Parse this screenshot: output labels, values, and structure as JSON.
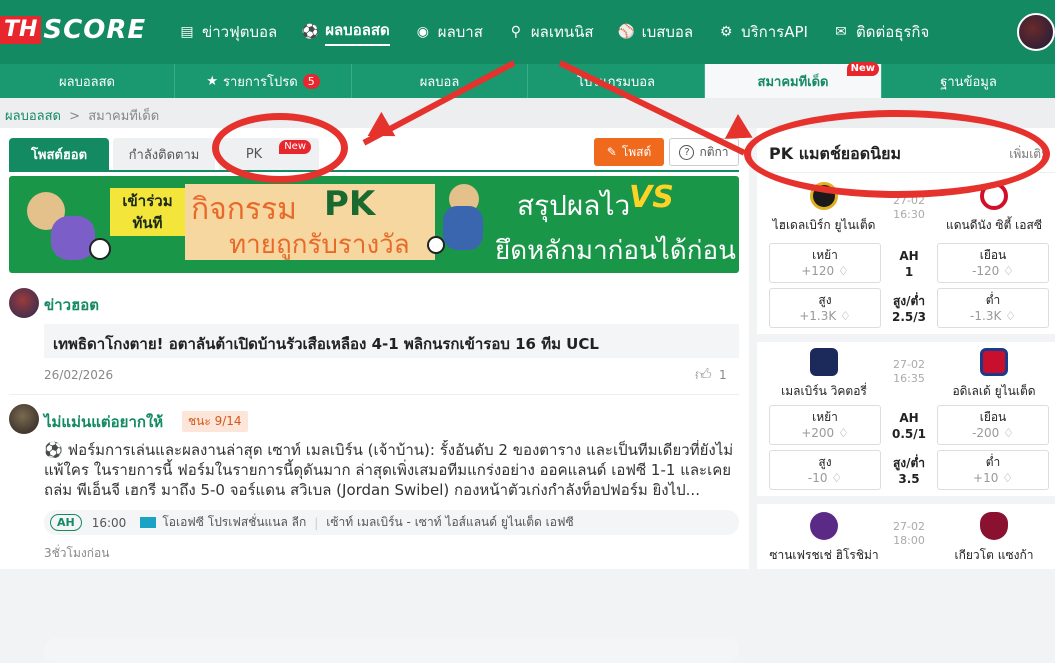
{
  "brand": {
    "th": "TH",
    "score": "SCORE"
  },
  "nav": [
    {
      "icon": "news-icon",
      "glyph": "▤",
      "label": "ข่าวฟุตบอล"
    },
    {
      "icon": "football-icon",
      "glyph": "⚽",
      "label": "ผลบอลสด",
      "active": true
    },
    {
      "icon": "basketball-icon",
      "glyph": "◉",
      "label": "ผลบาส"
    },
    {
      "icon": "tennis-icon",
      "glyph": "⚲",
      "label": "ผลเทนนิส"
    },
    {
      "icon": "baseball-icon",
      "glyph": "⚾",
      "label": "เบสบอล"
    },
    {
      "icon": "api-icon",
      "glyph": "⚙",
      "label": "บริการAPI"
    },
    {
      "icon": "contact-icon",
      "glyph": "✉",
      "label": "ติดต่อธุรกิจ"
    }
  ],
  "subnav": [
    {
      "label": "ผลบอลสด"
    },
    {
      "label": "รายการโปรด",
      "badge": "5"
    },
    {
      "label": "ผลบอล"
    },
    {
      "label": "โปรแกรมบอล"
    },
    {
      "label": "สมาคมทีเด็ด",
      "new": "New",
      "active": true
    },
    {
      "label": "ฐานข้อมูล"
    }
  ],
  "breadcrumb": {
    "home": "ผลบอลสด",
    "sep": ">",
    "current": "สมาคมทีเด็ด"
  },
  "tabs": {
    "hot": "โพสต์ฮอต",
    "following": "กำลังติดตาม",
    "pk": "PK",
    "pk_new": "New"
  },
  "actions": {
    "post": "โพสต์",
    "rules": "กติกา"
  },
  "banner": {
    "join_1": "เข้าร่วม",
    "join_2": "ทันที",
    "activity": "กิจกรรม",
    "pk": "PK",
    "guess": "ทายถูกรับรางวัล",
    "summary": "สรุปผลไว",
    "vs": "VS",
    "tagline": "ยึดหลักมาก่อนได้ก่อน"
  },
  "hot_news": {
    "title": "ข่าวฮอต",
    "headline": "เทพธิดาโกงตาย! อตาลันต้าเปิดบ้านรัวเสือเหลือง 4-1 พลิกนรกเข้ารอบ 16 ทีม UCL",
    "date": "26/02/2026",
    "likes": "1"
  },
  "post": {
    "author": "ไม่แม่นแต่อยากให้",
    "streak": "ชนะ 9/14",
    "text": "⚽ ฟอร์มการเล่นและผลงานล่าสุด เซาท์ เมลเบิร์น (เจ้าบ้าน): รั้งอันดับ 2 ของตาราง และเป็นทีมเดียวที่ยังไม่แพ้ใคร ในรายการนี้ ฟอร์มในรายการนี้ดุดันมาก ล่าสุดเพิ่งเสมอทีมแกร่งอย่าง ออคแลนด์ เอฟซี 1-1 และเคยถล่ม พีเอ็นจี เฮกรี มาถึง 5-0 จอร์แดน สวิเบล (Jordan Swibel) กองหน้าตัวเก่งกำลังท็อปฟอร์ม ยิงไป...",
    "market": "AH",
    "time": "16:00",
    "league": "โอเอฟซี โปรเฟสชั่นแนล ลีก",
    "fixture": "เซ้าท์ เมลเบิร์น - เซาท์ ไอส์แลนด์ ยูไนเต็ด เอฟซี",
    "ago": "3ชั่วโมงก่อน"
  },
  "pk_panel": {
    "title": "PK แมตช์ยอดนิยม",
    "more": "เพิ่มเติม",
    "matches": [
      {
        "home": "ไฮเดลเบิร์ก ยูไนเต็ด",
        "away": "แดนดีนัง ซิตี้ เอสซี",
        "date": "27-02",
        "time": "16:30",
        "home_odd_label": "เหย้า",
        "home_odd": "+120",
        "ah_label": "AH",
        "ah_line": "1",
        "away_odd_label": "เยือน",
        "away_odd": "-120",
        "over_label": "สูง",
        "over": "+1.3K",
        "ou_label": "สูง/ต่ำ",
        "ou_line": "2.5/3",
        "under_label": "ต่ำ",
        "under": "-1.3K",
        "home_color": "#1a1a1a",
        "away_color": "#d0102a"
      },
      {
        "home": "เมลเบิร์น วิคตอรี่",
        "away": "อดิเลเด้ ยูไนเต็ด",
        "date": "27-02",
        "time": "16:35",
        "home_odd_label": "เหย้า",
        "home_odd": "+200",
        "ah_label": "AH",
        "ah_line": "0.5/1",
        "away_odd_label": "เยือน",
        "away_odd": "-200",
        "over_label": "สูง",
        "over": "-10",
        "ou_label": "สูง/ต่ำ",
        "ou_line": "3.5",
        "under_label": "ต่ำ",
        "under": "+10",
        "home_color": "#1b2a5a",
        "away_color": "#c8102e"
      },
      {
        "home": "ซานเฟรชเช่ ฮิโรชิม่า",
        "away": "เกียวโต แซงก้า",
        "date": "27-02",
        "time": "18:00",
        "home_color": "#5b2a86",
        "away_color": "#8a1230"
      }
    ]
  }
}
